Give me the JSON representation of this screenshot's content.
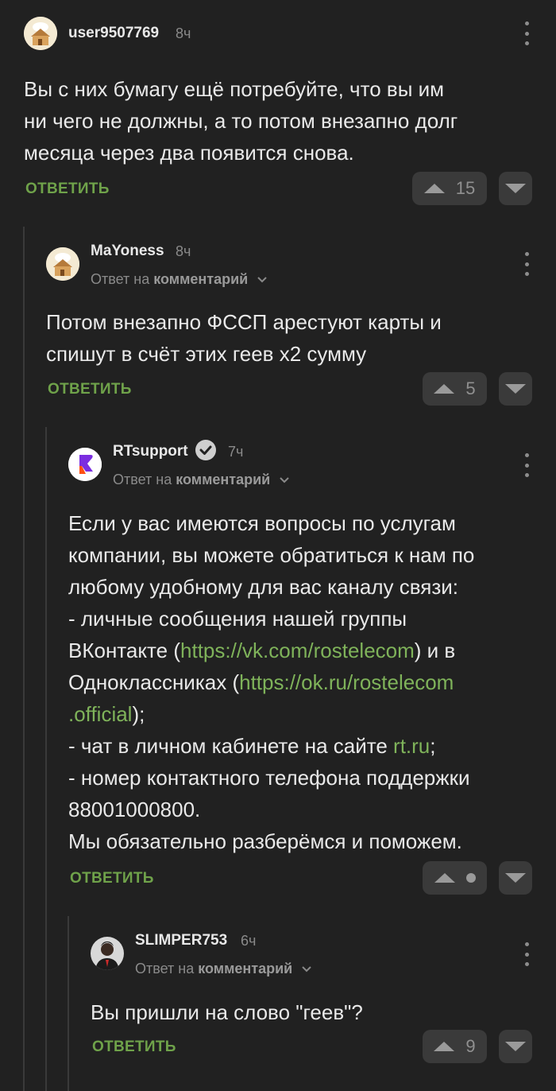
{
  "comments": [
    {
      "username": "user9507769",
      "time": "8ч",
      "lines": [
        "Вы с них бумагу ещё потребуйте, что вы им",
        "ни чего не должны, а то потом внезапно долг",
        "месяца через два появится снова."
      ],
      "reply_label": "ОТВЕТИТЬ",
      "rating": "15"
    },
    {
      "username": "MaYoness",
      "time": "8ч",
      "reply_prefix": "Ответ на",
      "reply_target": "комментарий",
      "lines": [
        "Потом внезапно ФССП арестуют карты и",
        "спишут в счёт этих геев x2 сумму"
      ],
      "reply_label": "ОТВЕТИТЬ",
      "rating": "5"
    },
    {
      "username": "RTsupport",
      "time": "7ч",
      "verified": true,
      "reply_prefix": "Ответ на",
      "reply_target": "комментарий",
      "text": {
        "l1": "Если у вас имеются вопросы по услугам",
        "l2": "компании, вы можете обратиться к нам по",
        "l3": "любому удобному для вас каналу связи:",
        "l4": "- личные сообщения нашей группы",
        "l5_a": "ВКонтакте (",
        "l5_link": "https://vk.com/rostelecom",
        "l5_b": ") и в",
        "l6_a": "Одноклассниках (",
        "l6_link": "https://ok.ru/rostelecom",
        "l7_link": ".official",
        "l7_b": ");",
        "l8_a": "- чат в личном кабинете на сайте ",
        "l8_link": "rt.ru",
        "l8_b": ";",
        "l9": "- номер контактного телефона поддержки",
        "l10": "88001000800.",
        "l11": "Мы обязательно разберёмся и поможем."
      },
      "reply_label": "ОТВЕТИТЬ",
      "rating_hidden": true
    },
    {
      "username": "SLIMPER753",
      "time": "6ч",
      "reply_prefix": "Ответ на",
      "reply_target": "комментарий",
      "lines": [
        "Вы пришли на слово \"геев\"?"
      ],
      "reply_label": "ОТВЕТИТЬ",
      "rating": "9"
    }
  ],
  "icons": {
    "menu": "vertical-dots-icon",
    "upvote": "triangle-up-icon",
    "downvote": "triangle-down-icon",
    "verified": "check-badge-icon",
    "chevron": "chevron-down-icon"
  },
  "colors": {
    "background": "#212121",
    "accent_green": "#6fa24a",
    "link_green": "#7fb35a",
    "button_bg": "#3a3a3a"
  }
}
